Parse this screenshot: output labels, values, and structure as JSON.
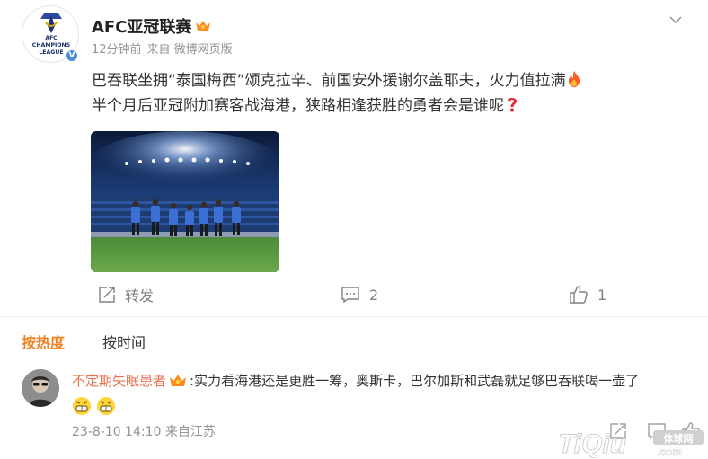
{
  "post": {
    "username": "AFC亚冠联赛",
    "avatar_text": {
      "line1": "AFC",
      "line2": "CHAMPIONS",
      "line3": "LEAGUE"
    },
    "time": "12分钟前",
    "source": "来自 微博网页版",
    "text_line1": "巴吞联坐拥“泰国梅西”颂克拉辛、前国安外援谢尔盖耶夫，火力值拉满",
    "text_line2": "半个月后亚冠附加赛客战海港，狭路相逢获胜的勇者会是谁呢",
    "emoji1": "fire-icon",
    "emoji2": "question-icon"
  },
  "actions": {
    "repost_label": "转发",
    "comment_count": "2",
    "like_count": "1"
  },
  "sort": {
    "hot_label": "按热度",
    "time_label": "按时间"
  },
  "comment": {
    "username": "不定期失眠患者",
    "text": ":实力看海港还是更胜一筹，奥斯卡，巴尔加斯和武磊就足够巴吞联喝一壶了",
    "time": "23-8-10 14:10 来自江苏"
  },
  "watermark": {
    "text": "TiQiu",
    "suffix": ".com",
    "badge": "体球网"
  },
  "colors": {
    "accent_orange": "#f08223",
    "comment_user": "#eb7350",
    "meta_gray": "#939393"
  }
}
